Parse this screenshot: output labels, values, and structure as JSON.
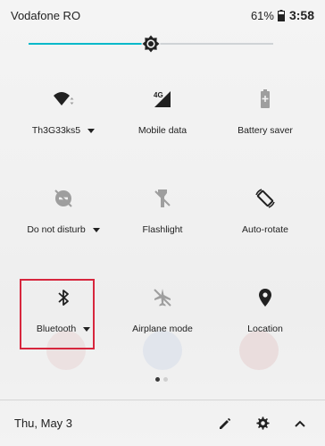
{
  "status_bar": {
    "carrier": "Vodafone RO",
    "battery_percent": "61%",
    "time": "3:58",
    "battery_icon": "battery-icon"
  },
  "brightness": {
    "level": 0.5,
    "accent_color": "#00b8c9",
    "icon": "brightness-icon"
  },
  "tiles": [
    {
      "label": "Th3G33ks5",
      "icon": "wifi-icon",
      "has_dropdown": true
    },
    {
      "label": "Mobile data",
      "icon": "mobile-data-icon",
      "has_dropdown": false
    },
    {
      "label": "Battery saver",
      "icon": "battery-saver-icon",
      "has_dropdown": false
    },
    {
      "label": "Do not disturb",
      "icon": "do-not-disturb-icon",
      "has_dropdown": true
    },
    {
      "label": "Flashlight",
      "icon": "flashlight-icon",
      "has_dropdown": false
    },
    {
      "label": "Auto-rotate",
      "icon": "auto-rotate-icon",
      "has_dropdown": false
    },
    {
      "label": "Bluetooth",
      "icon": "bluetooth-icon",
      "has_dropdown": true
    },
    {
      "label": "Airplane mode",
      "icon": "airplane-mode-icon",
      "has_dropdown": false
    },
    {
      "label": "Location",
      "icon": "location-icon",
      "has_dropdown": false
    }
  ],
  "highlight_color": "#d7263d",
  "page_indicator": {
    "pages": 2,
    "current": 1
  },
  "footer": {
    "date": "Thu, May 3",
    "edit_icon": "edit-icon",
    "settings_icon": "settings-icon",
    "collapse_icon": "chevron-up-icon"
  }
}
